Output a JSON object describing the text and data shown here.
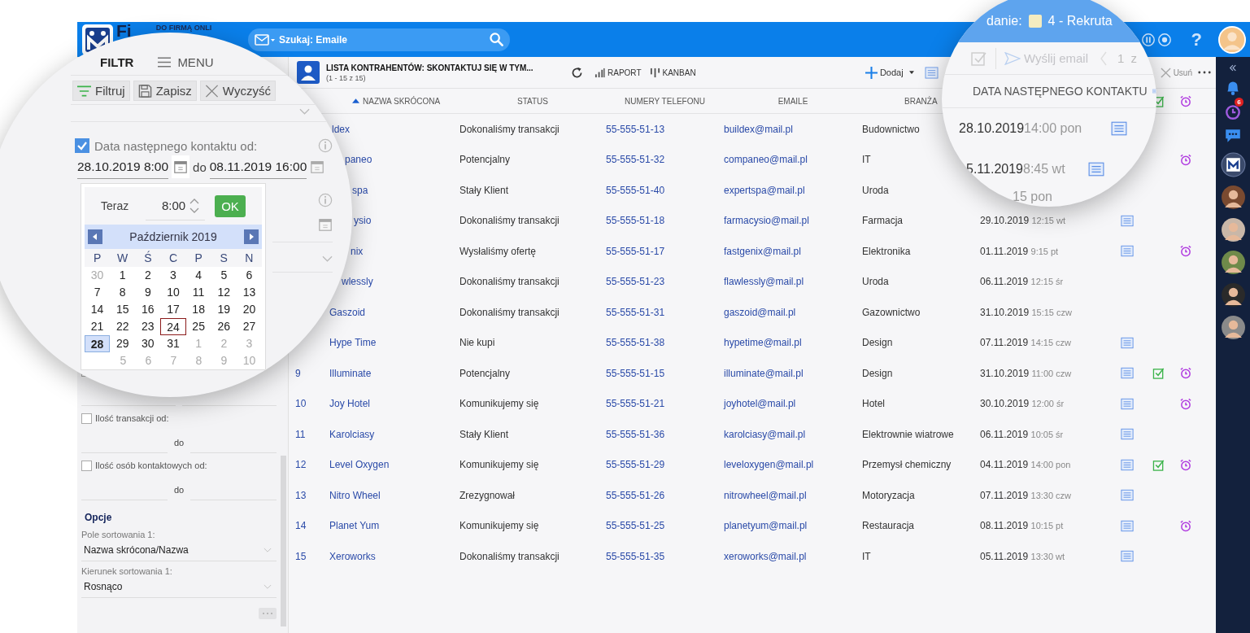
{
  "header": {
    "logo_text": "Fi",
    "tagline": "DO FIRMĄ ONLI",
    "search": {
      "placeholder": "Szukaj: Emaile"
    },
    "help": "?"
  },
  "left_panel": {
    "tabs": [
      {
        "label": "FILTR",
        "selected": true
      },
      {
        "label": "MENU",
        "selected": false
      }
    ],
    "toolbar": [
      "Filtruj",
      "Zapisz",
      "Wyczyść"
    ],
    "date_filter": {
      "checked": true,
      "label": "Data następnego kontaktu od:",
      "from": "28.10.2019 8:00",
      "to_label": "do",
      "to": "08.11.2019 16:00"
    },
    "datepicker": {
      "now_label": "Teraz",
      "time": "8:00",
      "ok": "OK",
      "month": "Październik 2019",
      "weekdays": [
        "P",
        "W",
        "Ś",
        "C",
        "P",
        "S",
        "N"
      ],
      "weeks": [
        [
          {
            "day": "30",
            "muted": true,
            "today": false,
            "selected": false
          },
          {
            "day": "1",
            "muted": false,
            "today": false,
            "selected": false
          },
          {
            "day": "2",
            "muted": false,
            "today": false,
            "selected": false
          },
          {
            "day": "3",
            "muted": false,
            "today": false,
            "selected": false
          },
          {
            "day": "4",
            "muted": false,
            "today": false,
            "selected": false
          },
          {
            "day": "5",
            "muted": false,
            "today": false,
            "selected": false
          },
          {
            "day": "6",
            "muted": false,
            "today": false,
            "selected": false
          }
        ],
        [
          {
            "day": "7",
            "muted": false,
            "today": false,
            "selected": false
          },
          {
            "day": "8",
            "muted": false,
            "today": false,
            "selected": false
          },
          {
            "day": "9",
            "muted": false,
            "today": false,
            "selected": false
          },
          {
            "day": "10",
            "muted": false,
            "today": false,
            "selected": false
          },
          {
            "day": "11",
            "muted": false,
            "today": false,
            "selected": false
          },
          {
            "day": "12",
            "muted": false,
            "today": false,
            "selected": false
          },
          {
            "day": "13",
            "muted": false,
            "today": false,
            "selected": false
          }
        ],
        [
          {
            "day": "14",
            "muted": false,
            "today": false,
            "selected": false
          },
          {
            "day": "15",
            "muted": false,
            "today": false,
            "selected": false
          },
          {
            "day": "16",
            "muted": false,
            "today": false,
            "selected": false
          },
          {
            "day": "17",
            "muted": false,
            "today": false,
            "selected": false
          },
          {
            "day": "18",
            "muted": false,
            "today": false,
            "selected": false
          },
          {
            "day": "19",
            "muted": false,
            "today": false,
            "selected": false
          },
          {
            "day": "20",
            "muted": false,
            "today": false,
            "selected": false
          }
        ],
        [
          {
            "day": "21",
            "muted": false,
            "today": false,
            "selected": false
          },
          {
            "day": "22",
            "muted": false,
            "today": false,
            "selected": false
          },
          {
            "day": "23",
            "muted": false,
            "today": false,
            "selected": false
          },
          {
            "day": "24",
            "muted": false,
            "today": true,
            "selected": false
          },
          {
            "day": "25",
            "muted": false,
            "today": false,
            "selected": false
          },
          {
            "day": "26",
            "muted": false,
            "today": false,
            "selected": false
          },
          {
            "day": "27",
            "muted": false,
            "today": false,
            "selected": false
          }
        ],
        [
          {
            "day": "28",
            "muted": false,
            "today": false,
            "selected": true
          },
          {
            "day": "29",
            "muted": false,
            "today": false,
            "selected": false
          },
          {
            "day": "30",
            "muted": false,
            "today": false,
            "selected": false
          },
          {
            "day": "31",
            "muted": false,
            "today": false,
            "selected": false
          },
          {
            "day": "1",
            "muted": true,
            "today": false,
            "selected": false
          },
          {
            "day": "2",
            "muted": true,
            "today": false,
            "selected": false
          },
          {
            "day": "3",
            "muted": true,
            "today": false,
            "selected": false
          }
        ],
        [
          {
            "day": "5",
            "muted": true,
            "today": false,
            "selected": false
          },
          {
            "day": "6",
            "muted": true,
            "today": false,
            "selected": false
          },
          {
            "day": "7",
            "muted": true,
            "today": false,
            "selected": false
          },
          {
            "day": "8",
            "muted": true,
            "today": false,
            "selected": false
          },
          {
            "day": "9",
            "muted": true,
            "today": false,
            "selected": false
          },
          {
            "day": "10",
            "muted": true,
            "today": false,
            "selected": false
          }
        ]
      ]
    },
    "partial_checkbox": {
      "checked": false
    },
    "filters": [
      {
        "checked": false,
        "label": "Ilość transakcji od:",
        "to_label": "do"
      },
      {
        "checked": false,
        "label": "Ilość osób kontaktowych od:",
        "to_label": "do"
      }
    ],
    "options": {
      "title": "Opcje",
      "fields": [
        {
          "label": "Pole sortowania 1:",
          "value": "Nazwa skrócona/Nazwa"
        },
        {
          "label": "Kierunek sortowania 1:",
          "value": "Rosnąco"
        }
      ]
    }
  },
  "main": {
    "title": "LISTA KONTRAHENTÓW: SKONTAKTUJ SIĘ W TYM...",
    "subtitle": "(1 - 15 z 15)",
    "actions": [
      {
        "kind": "report",
        "label": "RAPORT"
      },
      {
        "kind": "kanban",
        "label": "KANBAN"
      }
    ],
    "add": "Dodaj",
    "delete": "Usuń",
    "columns": [
      {
        "label": "NAZWA SKRÓCONA",
        "sorted": true
      },
      {
        "label": "STATUS",
        "sorted": false
      },
      {
        "label": "NUMERY TELEFONU",
        "sorted": false
      },
      {
        "label": "EMAILE",
        "sorted": false
      },
      {
        "label": "BRANŻA",
        "sorted": false
      }
    ],
    "rows": [
      {
        "name": "ldex",
        "status": "Dokonaliśmy transakcji",
        "phone": "55-555-51-13",
        "email": "buildex@mail.pl",
        "industry": "Budownictwo",
        "done": false,
        "alarm": false
      },
      {
        "name": "paneo",
        "status": "Potencjalny",
        "phone": "55-555-51-32",
        "email": "companeo@mail.pl",
        "industry": "IT",
        "done": false,
        "alarm": true
      },
      {
        "name": "spa",
        "status": "Stały Klient",
        "phone": "55-555-51-40",
        "email": "expertspa@mail.pl",
        "industry": "Uroda",
        "notes": false,
        "done": false,
        "alarm": false
      },
      {
        "name": "ysio",
        "status": "Dokonaliśmy transakcji",
        "phone": "55-555-51-18",
        "email": "farmacysio@mail.pl",
        "industry": "Farmacja",
        "date": "29.10.2019",
        "time": "12:15 wt",
        "notes": true,
        "done": false,
        "alarm": false
      },
      {
        "name": "nix",
        "status": "Wysłaliśmy ofertę",
        "phone": "55-555-51-17",
        "email": "fastgenix@mail.pl",
        "industry": "Elektronika",
        "date": "01.11.2019",
        "time": "9:15 pt",
        "notes": true,
        "done": false,
        "alarm": true
      },
      {
        "name": "wlessly",
        "status": "Dokonaliśmy transakcji",
        "phone": "55-555-51-23",
        "email": "flawlessly@mail.pl",
        "industry": "Uroda",
        "date": "06.11.2019",
        "time": "12:15 śr",
        "notes": false,
        "done": false,
        "alarm": false
      },
      {
        "name": "Gaszoid",
        "status": "Dokonaliśmy transakcji",
        "phone": "55-555-51-31",
        "email": "gaszoid@mail.pl",
        "industry": "Gazownictwo",
        "date": "31.10.2019",
        "time": "15:15 czw",
        "notes": false,
        "done": false,
        "alarm": false
      },
      {
        "name": "Hype Time",
        "status": "Nie kupi",
        "phone": "55-555-51-38",
        "email": "hypetime@mail.pl",
        "industry": "Design",
        "date": "07.11.2019",
        "time": "14:15 czw",
        "notes": true,
        "done": false,
        "alarm": false
      },
      {
        "number": "9",
        "name": "Illuminate",
        "status": "Potencjalny",
        "phone": "55-555-51-15",
        "email": "illuminate@mail.pl",
        "industry": "Design",
        "date": "31.10.2019",
        "time": "11:00 czw",
        "notes": true,
        "done": true,
        "alarm": true
      },
      {
        "number": "10",
        "name": "Joy Hotel",
        "status": "Komunikujemy się",
        "phone": "55-555-51-21",
        "email": "joyhotel@mail.pl",
        "industry": "Hotel",
        "date": "30.10.2019",
        "time": "12:00 śr",
        "notes": true,
        "done": false,
        "alarm": true
      },
      {
        "number": "11",
        "name": "Karolciasy",
        "status": "Stały Klient",
        "phone": "55-555-51-36",
        "email": "karolciasy@mail.pl",
        "industry": "Elektrownie wiatrowe",
        "date": "06.11.2019",
        "time": "10:05 śr",
        "notes": true,
        "done": false,
        "alarm": false
      },
      {
        "number": "12",
        "name": "Level Oxygen",
        "status": "Komunikujemy się",
        "phone": "55-555-51-29",
        "email": "leveloxygen@mail.pl",
        "industry": "Przemysł chemiczny",
        "date": "04.11.2019",
        "time": "14:00 pon",
        "notes": true,
        "done": true,
        "alarm": true
      },
      {
        "number": "13",
        "name": "Nitro Wheel",
        "status": "Zrezygnował",
        "phone": "55-555-51-26",
        "email": "nitrowheel@mail.pl",
        "industry": "Motoryzacja",
        "date": "07.11.2019",
        "time": "13:30 czw",
        "notes": true,
        "done": false,
        "alarm": false
      },
      {
        "number": "14",
        "name": "Planet Yum",
        "status": "Komunikujemy się",
        "phone": "55-555-51-25",
        "email": "planetyum@mail.pl",
        "industry": "Restauracja",
        "date": "08.11.2019",
        "time": "10:15 pt",
        "notes": true,
        "done": false,
        "alarm": true
      },
      {
        "number": "15",
        "name": "Xeroworks",
        "status": "Dokonaliśmy transakcji",
        "phone": "55-555-51-35",
        "email": "xeroworks@mail.pl",
        "industry": "IT",
        "date": "05.11.2019",
        "time": "13:30 wt",
        "notes": true,
        "done": false,
        "alarm": false
      }
    ]
  },
  "zoom_overlay": {
    "task_label": "danie:",
    "task": "4 - Rekruta",
    "send": "Wyślij email",
    "page": "1",
    "page_of": "z",
    "column": "DATA NASTĘPNEGO KONTAKTU",
    "rows": [
      {
        "date": "28.10.2019",
        "time": "14:00 pon",
        "notes": true
      },
      {
        "date": "5.11.2019",
        "time": "8:45 wt",
        "notes": true
      },
      {
        "time": "15 pon"
      }
    ]
  },
  "rail": {
    "badge": "6"
  }
}
